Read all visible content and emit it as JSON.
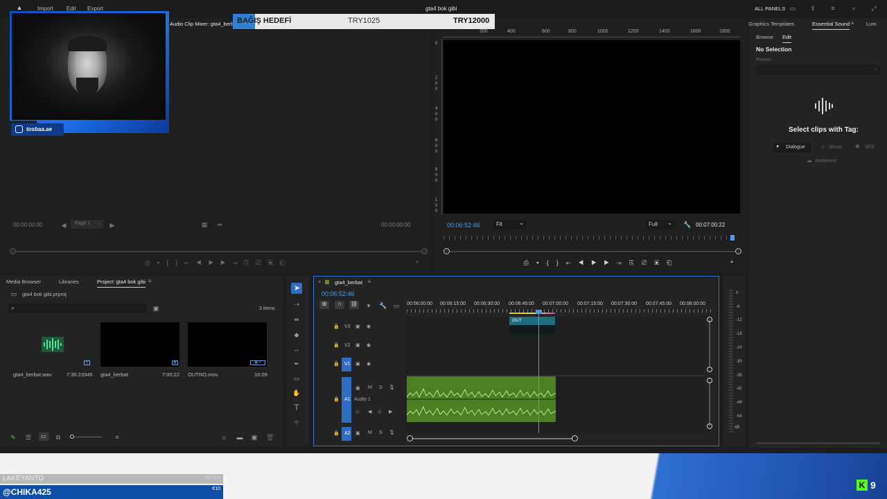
{
  "app": {
    "menu": [
      "Import",
      "Edit",
      "Export"
    ],
    "title": "gta4 bok gibi",
    "top_right": {
      "all_panels": "ALL PANELS"
    }
  },
  "overlay": {
    "donation": {
      "label": "BAĞIŞ HEDEFİ",
      "current": "TRY1025",
      "goal": "TRY12000"
    },
    "webcam": {
      "handle": "tosbaa.ae"
    },
    "ticker": {
      "top_line": "LAKEYANTO",
      "top_amount": "TRY 500",
      "name": "@CHIKA425",
      "amount": "€10"
    },
    "kick_count": "9"
  },
  "source_panel": {
    "tab": "Audio Clip Mixer: gta4_berbat",
    "timecode_left": "00:00:00:00",
    "page": "Page 1",
    "timecode_right": "00:00:00:00"
  },
  "program_panel": {
    "timecode": "00:06:52:46",
    "fit": "Fit",
    "quality": "Full",
    "duration": "00:07:00:22",
    "ruler_top": [
      "200",
      "400",
      "600",
      "800",
      "1000",
      "1200",
      "1400",
      "1600",
      "1800"
    ],
    "ruler_left": [
      "0",
      "2",
      "0",
      "0",
      "4",
      "0",
      "0",
      "6",
      "0",
      "0",
      "8",
      "0",
      "0",
      "1",
      "0",
      "0"
    ]
  },
  "essential_sound": {
    "tabs": [
      "Graphics Templates",
      "Essential Sound",
      "Lum"
    ],
    "subtabs": [
      "Browse",
      "Edit"
    ],
    "no_selection": "No Selection",
    "preset_label": "Preset:",
    "select_text": "Select clips with Tag:",
    "tags": [
      "Dialogue",
      "Music",
      "SFX",
      "Ambience"
    ]
  },
  "project": {
    "tabs": [
      "Media Browser",
      "Libraries",
      "Project: gta4 bok gibi"
    ],
    "file": "gta4 bok gibi.prproj",
    "items_count": "3 items",
    "items": [
      {
        "name": "gta4_berbat.wav",
        "duration": "7:36:23345"
      },
      {
        "name": "gta4_berbat",
        "duration": "7:00:22"
      },
      {
        "name": "OUTRO.mov",
        "duration": "16:09"
      }
    ]
  },
  "timeline": {
    "sequence": "gta4_berbat",
    "timecode": "00:06:52:46",
    "ruler": [
      "00:06:00:00",
      "00:06:15:00",
      "00:06:30:00",
      "00:06:45:00",
      "00:07:00:00",
      "00:07:15:00",
      "00:07:30:00",
      "00:07:45:00",
      "00:08:00:00"
    ],
    "tracks": [
      "V3",
      "V2",
      "V1",
      "A1",
      "A2"
    ],
    "audio_name": "Audio 1",
    "clip_label": "OUT",
    "track_buttons": {
      "mute": "M",
      "solo": "S"
    }
  },
  "meters": {
    "scale": [
      "0",
      "-6",
      "-12",
      "-18",
      "-24",
      "-30",
      "-36",
      "-42",
      "-48",
      "-54",
      "dB"
    ]
  },
  "colors": {
    "accent_blue": "#2f7fd4",
    "audio_green": "#4e8a2a",
    "clip_teal": "#2a8fa0",
    "playhead": "#4d9ce8"
  }
}
